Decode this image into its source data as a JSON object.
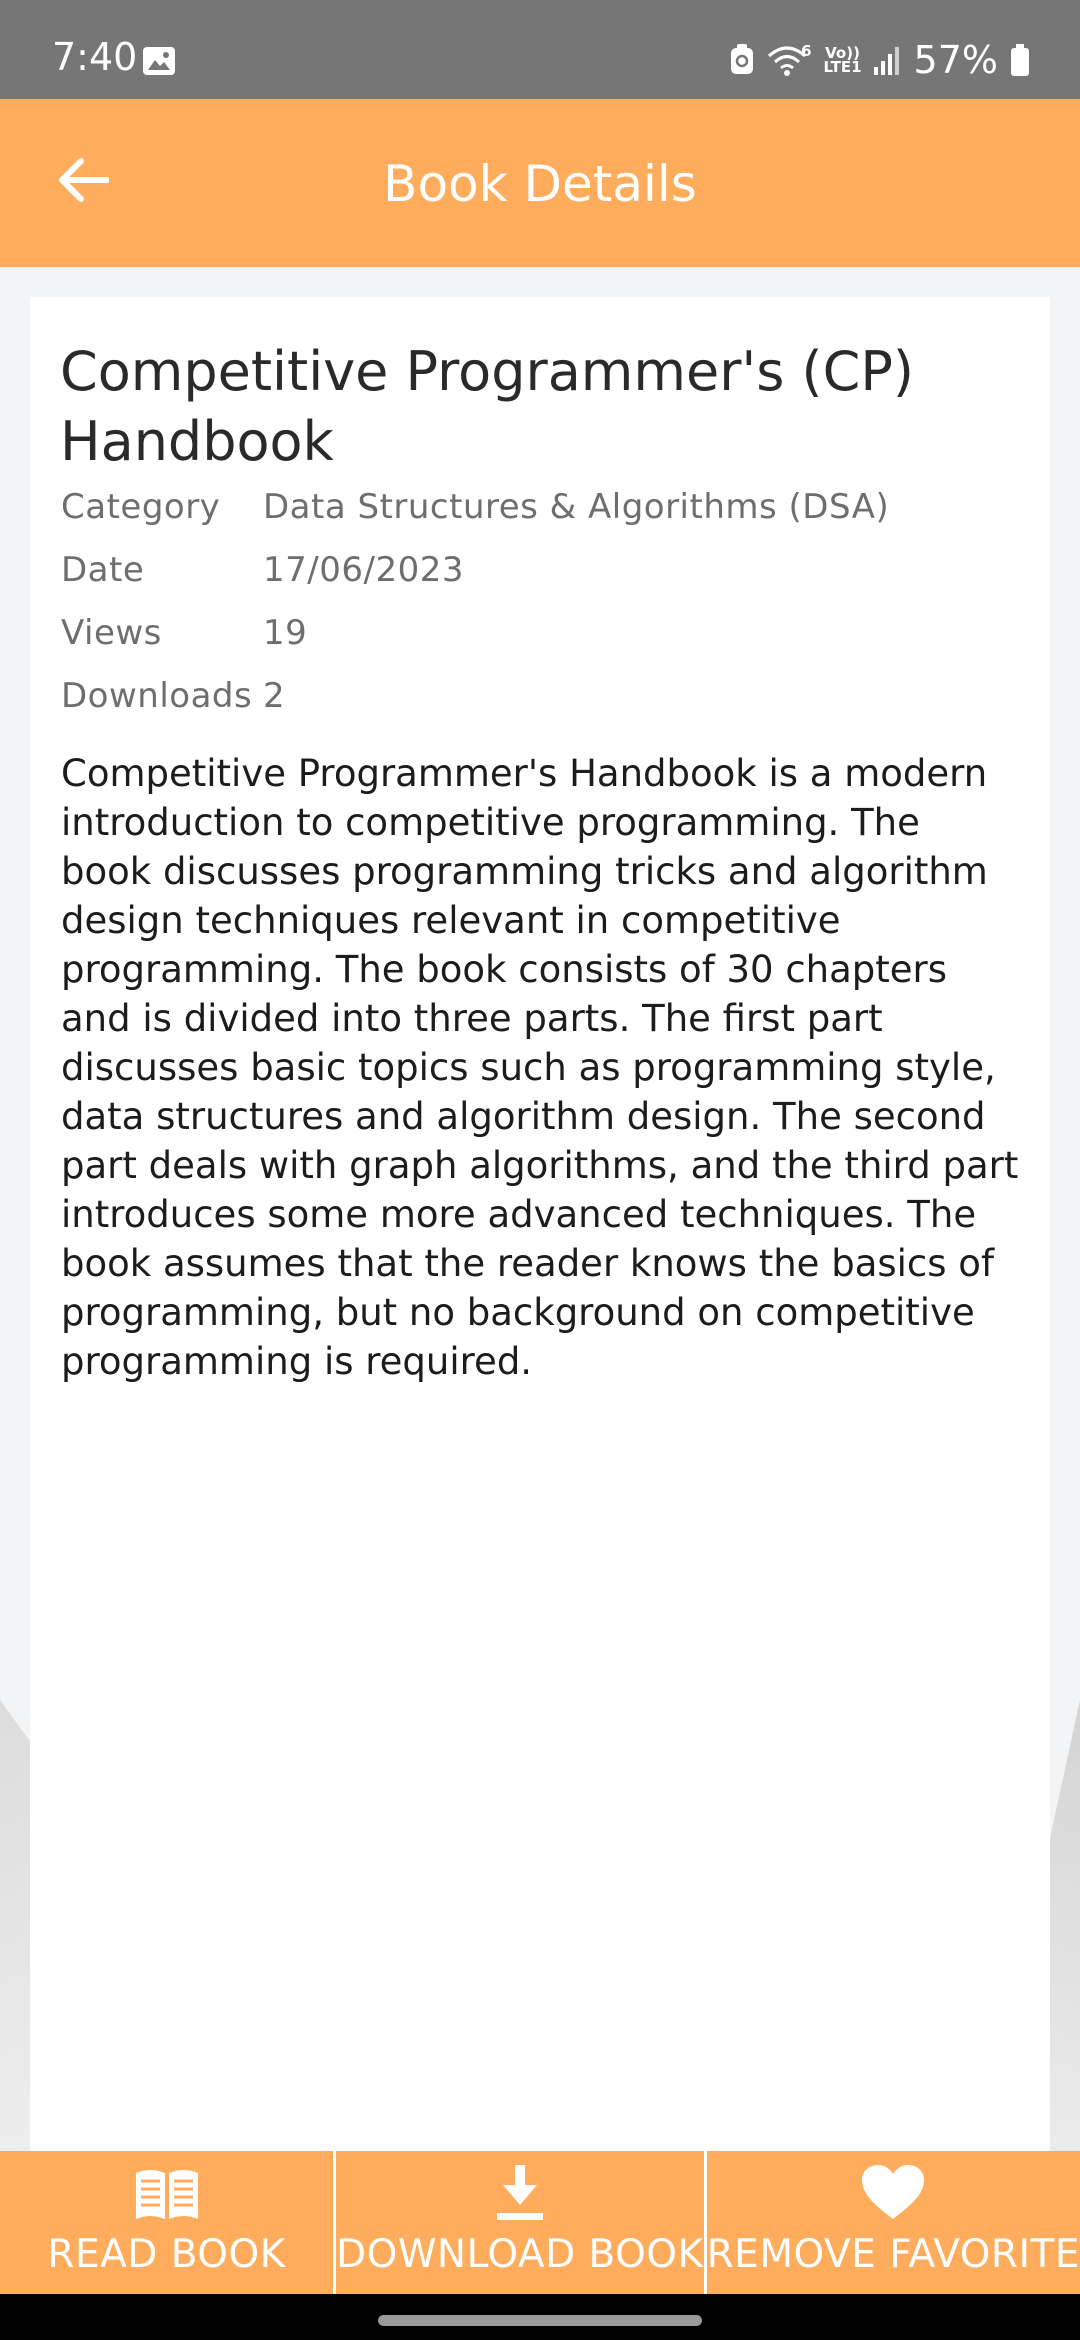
{
  "status_bar": {
    "time": "7:40",
    "battery_percent": "57%",
    "network_label_top": "Vo))",
    "network_label_bottom": "LTE1",
    "wifi_label": "6"
  },
  "app_bar": {
    "title": "Book Details",
    "back_icon": "arrow-left-icon"
  },
  "book": {
    "title": "Competitive Programmer's (CP) Handbook",
    "meta": [
      {
        "key": "Category",
        "value": "Data Structures & Algorithms (DSA)"
      },
      {
        "key": "Date",
        "value": "17/06/2023"
      },
      {
        "key": "Views",
        "value": "19"
      },
      {
        "key": "Downloads",
        "value": "2"
      }
    ],
    "description": "Competitive Programmer's Handbook is a modern introduction to competitive programming. The book discusses programming tricks and algorithm design techniques relevant in competitive programming. The book consists of 30 chapters and is divided into three parts. The first part discusses basic topics such as programming style, data structures and algorithm design. The second part deals with graph algorithms, and the third part introduces some more advanced techniques. The book assumes that the reader knows the basics of programming, but no background on competitive programming is required."
  },
  "actions": [
    {
      "label": "READ BOOK",
      "icon": "open-book-icon"
    },
    {
      "label": "DOWNLOAD BOOK",
      "icon": "download-icon"
    },
    {
      "label": "REMOVE FAVORITE",
      "icon": "heart-icon"
    }
  ],
  "colors": {
    "accent": "#ffad5c",
    "status_bar": "#767676",
    "background": "#f3f4f6"
  }
}
